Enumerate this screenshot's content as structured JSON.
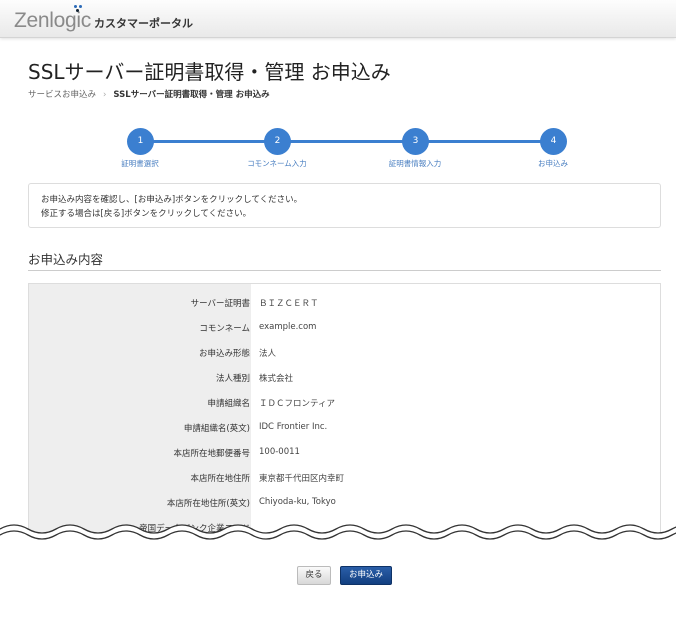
{
  "header": {
    "logo": "Zenlogic",
    "portal": "カスタマーポータル"
  },
  "page": {
    "title": "SSLサーバー証明書取得・管理 お申込み"
  },
  "breadcrumb": {
    "items": [
      "サービスお申込み",
      "SSLサーバー証明書取得・管理 お申込み"
    ],
    "separator": "›"
  },
  "steps": [
    {
      "num": "1",
      "label": "証明書選択"
    },
    {
      "num": "2",
      "label": "コモンネーム入力"
    },
    {
      "num": "3",
      "label": "証明書情報入力"
    },
    {
      "num": "4",
      "label": "お申込み"
    }
  ],
  "notice": {
    "line1": "お申込み内容を確認し、[お申込み]ボタンをクリックしてください。",
    "line2": "修正する場合は[戻る]ボタンをクリックしてください。"
  },
  "section": {
    "title": "お申込み内容"
  },
  "rows": [
    {
      "k": "サーバー証明書",
      "v": "ＢＩＺＣＥＲＴ"
    },
    {
      "k": "コモンネーム",
      "v": "example.com"
    },
    {
      "k": "お申込み形態",
      "v": "法人"
    },
    {
      "k": "法人種別",
      "v": "株式会社"
    },
    {
      "k": "申請組織名",
      "v": "ＩＤＣフロンティア"
    },
    {
      "k": "申請組織名(英文)",
      "v": "IDC Frontier Inc."
    },
    {
      "k": "本店所在地郵便番号",
      "v": "100-0011"
    },
    {
      "k": "本店所在地住所",
      "v": "東京都千代田区内幸町"
    },
    {
      "k": "本店所在地住所(英文)",
      "v": "Chiyoda-ku, Tokyo"
    },
    {
      "k": "帝国データバンク企業コード",
      "v": ""
    }
  ],
  "buttons": {
    "back": "戻る",
    "apply": "お申込み"
  },
  "colors": {
    "accent": "#3b7fd0",
    "primary_button": "#1a4b90"
  }
}
